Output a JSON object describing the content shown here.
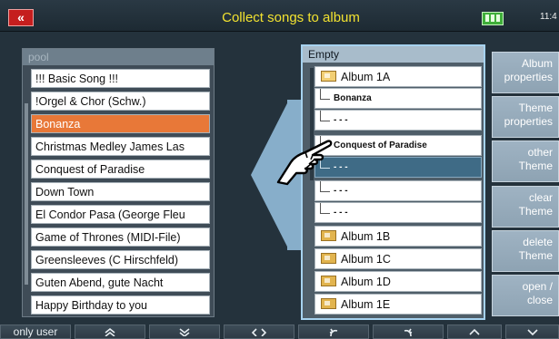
{
  "header": {
    "back_label": "«",
    "title": "Collect songs to album",
    "time": "11:4"
  },
  "pool": {
    "header": "pool",
    "items": [
      "!!! Basic Song !!!",
      "!Orgel & Chor (Schw.)",
      "Bonanza",
      "Christmas Medley James Las",
      "Conquest of Paradise",
      "Down Town",
      "El Condor Pasa (George Fleu",
      "Game of Thrones (MIDI-File)",
      "Greensleeves (C Hirschfeld)",
      "Guten Abend, gute Nacht",
      "Happy Birthday to you"
    ],
    "selected_index": 2
  },
  "album": {
    "header": "Empty",
    "rows": [
      {
        "label": "Album 1A"
      },
      {
        "label": "Bonanza"
      },
      {
        "label": "- - -"
      },
      {
        "label": "Conquest of Paradise"
      },
      {
        "label": "- - -"
      },
      {
        "label": "- - -"
      },
      {
        "label": "- - -"
      },
      {
        "label": "Album 1B"
      },
      {
        "label": "Album 1C"
      },
      {
        "label": "Album 1D"
      },
      {
        "label": "Album 1E"
      }
    ]
  },
  "side_buttons": [
    [
      "Album",
      "properties"
    ],
    [
      "Theme",
      "properties"
    ],
    [
      "other",
      "Theme"
    ],
    [
      "clear",
      "Theme"
    ],
    [
      "delete",
      "Theme"
    ],
    [
      "open  /",
      "close"
    ]
  ],
  "bottom_bar": {
    "only_user_label": "only user"
  },
  "colors": {
    "title": "#f2e230",
    "selected_song": "#e87838",
    "selected_album_row": "#3f6b86",
    "side_button": "#9aaebe"
  }
}
